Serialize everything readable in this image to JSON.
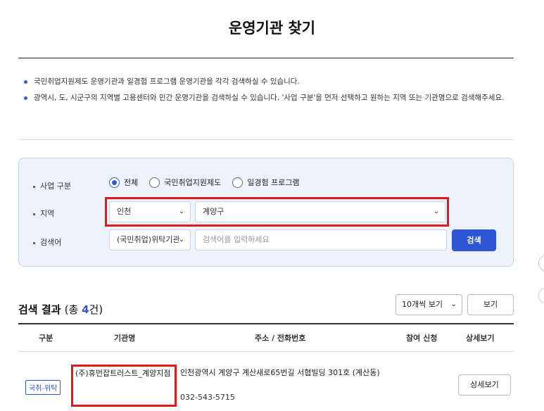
{
  "page": {
    "title": "운영기관 찾기"
  },
  "notes": [
    "국민취업지원제도 운영기관과 일경험 프로그램 운영기관을 각각 검색하실 수 있습니다.",
    "광역시, 도, 시군구의 지역별 고용센터와 민간 운영기관을 검색하실 수 있습니다. '사업 구분'을 먼저 선택하고 원하는 지역 또는 기관명으로 검색해주세요."
  ],
  "filters": {
    "business_label": "사업 구분",
    "business_options": [
      "전체",
      "국민취업지원제도",
      "일경험 프로그램"
    ],
    "business_selected": "전체",
    "region_label": "지역",
    "region_city": "인천",
    "region_district": "계양구",
    "search_label": "검색어",
    "search_kind": "(국민취업)위탁기관",
    "search_placeholder": "검색어를 입력하세요",
    "search_button": "검색",
    "accent_color": "#2e55d3",
    "highlight_color": "#e0191b"
  },
  "results": {
    "title": "검색 결과",
    "count_prefix": "(총 ",
    "count": "4",
    "count_suffix": "건)",
    "per_page": "10개씩 보기",
    "view_button": "보기",
    "columns": [
      "구분",
      "기관명",
      "주소 / 전화번호",
      "참여 신청",
      "상세보기"
    ],
    "rows": [
      {
        "kind": "국취-위탁",
        "name": "(주)휴먼잡트러스트_계양지점",
        "address": "인천광역시 계양구 계산새로65번길 서협빌딩 301호 (계산동)",
        "phone": "032-543-5715",
        "apply": "",
        "detail_button": "상세보기"
      }
    ]
  }
}
